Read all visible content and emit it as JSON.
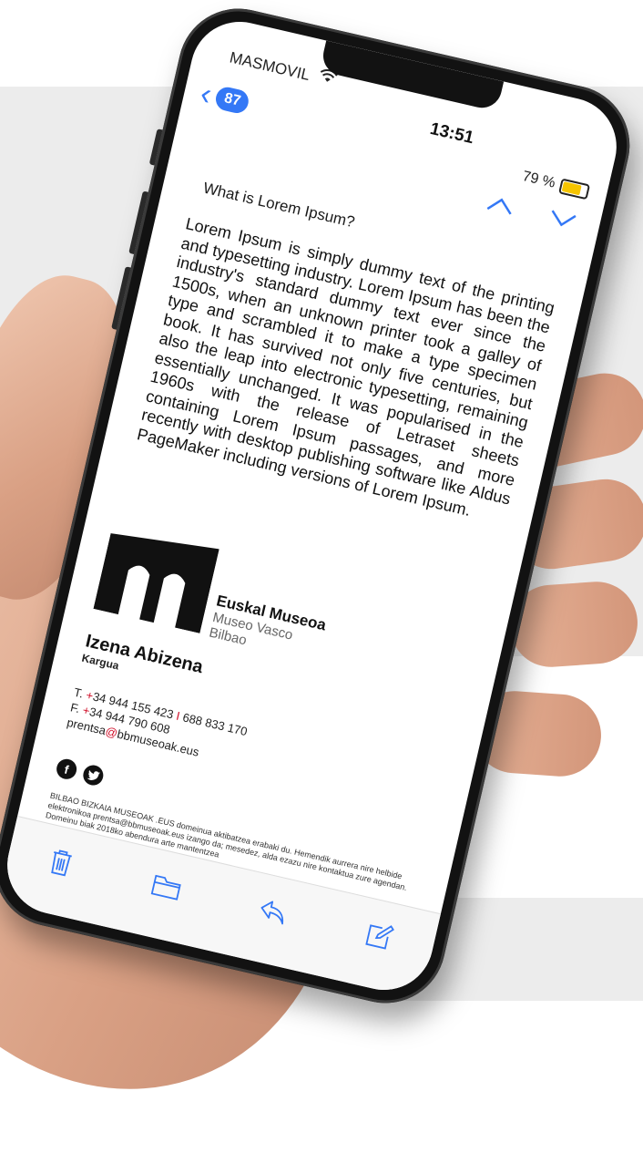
{
  "status_bar": {
    "carrier": "MASMOVIL",
    "time": "13:51",
    "battery": "79 %",
    "battery_level_pct": 79
  },
  "nav": {
    "unread_count": "87",
    "back_icon": "chevron-left-icon",
    "prev_icon": "chevron-up-icon",
    "next_icon": "chevron-down-icon"
  },
  "email": {
    "subject": "What is Lorem Ipsum?",
    "body": "Lorem Ipsum is simply dummy text of the printing and typesetting industry. Lorem Ipsum has been the industry's standard dummy text ever since the 1500s, when an unknown printer took a galley of type and scrambled it to make a type specimen book. It has survived not only five centuries, but also the leap into electronic typesetting, remaining essentially unchanged. It was popularised in the 1960s with the release of Letraset sheets containing Lorem Ipsum passages, and more recently with desktop publishing software like Aldus PageMaker including versions of Lorem Ipsum."
  },
  "signature": {
    "org_name": "Euskal Museoa",
    "org_line2": "Museo Vasco",
    "org_line3": "Bilbao",
    "person_name": "Izena Abizena",
    "person_role": "Kargua",
    "phone_prefix": "T. ",
    "phone_plus": "+",
    "phone_main": "34 944 155 423 ",
    "phone_sep": "I",
    "phone_mobile": " 688 833 170",
    "fax_prefix": "F. ",
    "fax_plus": "+",
    "fax_number": "34 944 790 608",
    "email_user": "prentsa",
    "email_at": "@",
    "email_domain": "bbmuseoak.eus",
    "legal": "BILBAO BIZKAIA MUSEOAK .EUS domeinua aktibatzea erabaki du. Hemendik aurrera nire helbide elektronikoa prentsa@bbmuseoak.eus izango da; mesedez, alda ezazu nire kontaktua zure agendan. Domeinu biak 2018ko abendura arte mantentzea"
  },
  "colors": {
    "accent": "#3478f6",
    "link_red": "#d0102a",
    "battery_fill": "#f5c400"
  }
}
